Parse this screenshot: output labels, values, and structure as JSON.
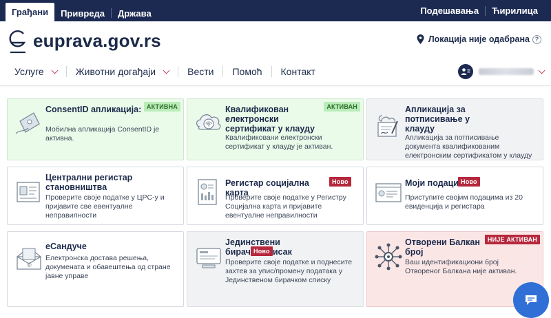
{
  "topbar": {
    "tabs": [
      {
        "label": "Грађани",
        "active": true
      },
      {
        "label": "Привреда",
        "active": false
      },
      {
        "label": "Држава",
        "active": false
      }
    ],
    "settings_label": "Подешавања",
    "script_label": "Ћирилица"
  },
  "header": {
    "brand": "euprava.gov.rs",
    "location_label": "Локација није одабрана"
  },
  "nav": {
    "items": [
      {
        "label": "Услуге",
        "dropdown": true
      },
      {
        "label": "Животни догађаји",
        "dropdown": true
      },
      {
        "label": "Вести",
        "dropdown": false
      },
      {
        "label": "Помоћ",
        "dropdown": false
      },
      {
        "label": "Контакт",
        "dropdown": false
      }
    ]
  },
  "cards": [
    {
      "title": "ConsentID апликација:",
      "desc": "Мобилна апликација ConsentID је активна.",
      "badge": "АКТИВНА",
      "state": "active",
      "icon": "consent-card-icon"
    },
    {
      "title": "Квалификован електронски сертификат у клауду",
      "desc": "Квалификовани електронски сертификат у клауду је активан.",
      "badge": "АКТИВАН",
      "state": "active",
      "icon": "cloud-fingerprint-icon"
    },
    {
      "title": "Апликација за потписивање у клауду",
      "desc": "Апликација за потписивање документа квалификованим електронским сертификатом у клауду",
      "badge": "",
      "state": "grey",
      "icon": "signing-document-icon"
    },
    {
      "title": "Централни регистар становништва",
      "desc": "Проверите своје податке у ЦРС-у и пријавите све евентуалне неправилности",
      "badge": "",
      "state": "normal",
      "icon": "id-document-icon"
    },
    {
      "title": "Регистар социјална карта",
      "desc": "Проверите своје податке у Регистру Социјална карта и пријавите евентуалне неправилности",
      "badge": "Ново",
      "state": "normal",
      "icon": "social-card-icon"
    },
    {
      "title": "Моји подаци",
      "desc": "Приступите својим подацима из 20 евиденција и регистара",
      "badge": "Ново",
      "state": "normal",
      "icon": "my-data-icon"
    },
    {
      "title": "еСандуче",
      "desc": "Електронска достава решења, докумената и обавештења од стране јавне управе",
      "badge": "",
      "state": "normal",
      "icon": "inbox-envelope-icon"
    },
    {
      "title": "Јединствени бирачки списак",
      "desc": "Проверите своје податке и поднесите захтев за упис/промену података у Јединственом бирачком списку",
      "badge": "Ново",
      "state": "grey",
      "icon": "voter-list-icon"
    },
    {
      "title": "Отворени Балкан број",
      "desc": "Ваш идентификациони број Отвореног Балкана није активан.",
      "badge": "НИЈЕ АКТИВАН",
      "state": "inactive",
      "icon": "network-gear-icon"
    }
  ],
  "colors": {
    "topbar": "#1c2a52",
    "accent_red": "#b6283d",
    "active_bg": "#eafbe9",
    "inactive_bg": "#fbe6e6",
    "chat_button": "#2f6fd6"
  }
}
